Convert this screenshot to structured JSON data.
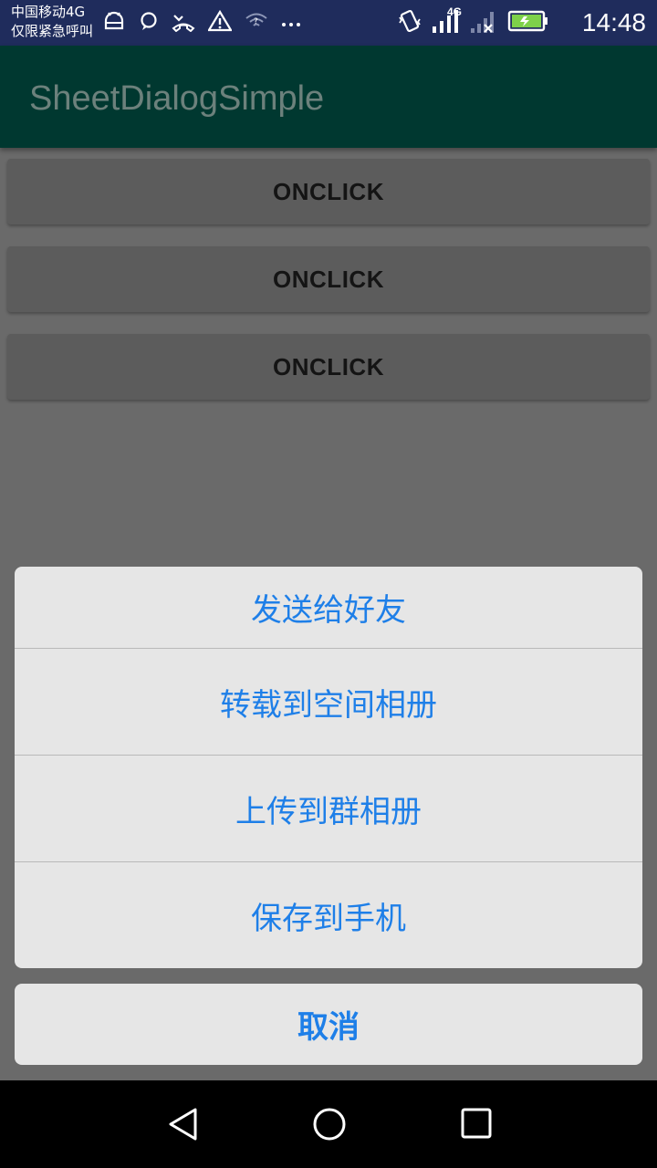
{
  "status_bar": {
    "carrier_line1": "中国移动4G",
    "carrier_line2": "仅限紧急呼叫",
    "network_label": "4G",
    "time": "14:48",
    "icons_left": [
      "android-icon",
      "chat-bubble-icon",
      "missed-call-icon",
      "warning-icon",
      "wifi-icon",
      "more-icon"
    ],
    "icons_right": [
      "vibrate-icon",
      "signal-icon",
      "signal-no-sim-icon",
      "battery-charging-icon"
    ]
  },
  "app_bar": {
    "title": "SheetDialogSimple"
  },
  "buttons": [
    {
      "label": "ONCLICK"
    },
    {
      "label": "ONCLICK"
    },
    {
      "label": "ONCLICK"
    }
  ],
  "sheet": {
    "items": [
      {
        "label": "发送给好友"
      },
      {
        "label": "转载到空间相册"
      },
      {
        "label": "上传到群相册"
      },
      {
        "label": "保存到手机"
      }
    ],
    "cancel_label": "取消"
  },
  "nav_bar": {
    "icons": [
      "back-icon",
      "home-icon",
      "recents-icon"
    ]
  },
  "colors": {
    "accent": "#1e7fe8",
    "app_bar": "#003830",
    "status_bar": "#1f2c5c",
    "scrim_background": "#6a6a6a"
  }
}
